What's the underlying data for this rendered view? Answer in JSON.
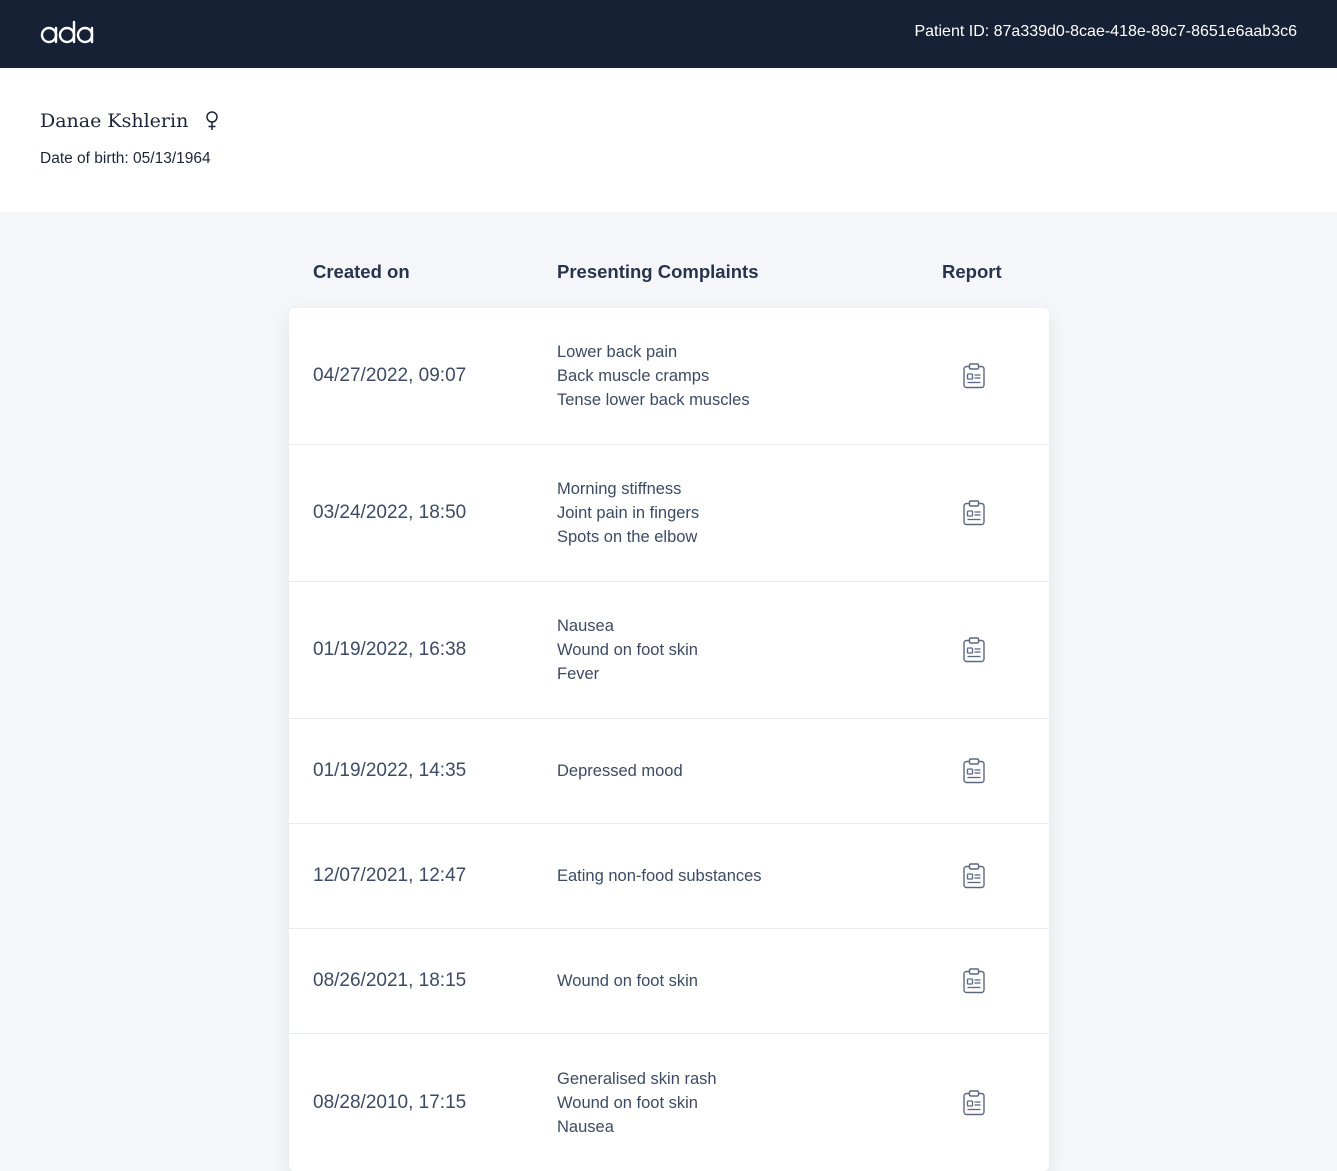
{
  "header": {
    "logo_text": "ada",
    "patient_id": "Patient ID: 87a339d0-8cae-418e-89c7-8651e6aab3c6"
  },
  "patient": {
    "name": "Danae Kshlerin",
    "gender_icon": "female-icon",
    "dob": "Date of birth: 05/13/1964"
  },
  "table": {
    "columns": {
      "created_on": "Created on",
      "complaints": "Presenting Complaints",
      "report": "Report"
    },
    "report_icon": "clipboard-report-icon",
    "rows": [
      {
        "date": "04/27/2022, 09:07",
        "complaints": [
          "Lower back pain",
          "Back muscle cramps",
          "Tense lower back muscles"
        ]
      },
      {
        "date": "03/24/2022, 18:50",
        "complaints": [
          "Morning stiffness",
          "Joint pain in fingers",
          "Spots on the elbow"
        ]
      },
      {
        "date": "01/19/2022, 16:38",
        "complaints": [
          "Nausea",
          "Wound on foot skin",
          "Fever"
        ]
      },
      {
        "date": "01/19/2022, 14:35",
        "complaints": [
          "Depressed mood"
        ]
      },
      {
        "date": "12/07/2021, 12:47",
        "complaints": [
          "Eating non-food substances"
        ]
      },
      {
        "date": "08/26/2021, 18:15",
        "complaints": [
          "Wound on foot skin"
        ]
      },
      {
        "date": "08/28/2010, 17:15",
        "complaints": [
          "Generalised skin rash",
          "Wound on foot skin",
          "Nausea"
        ]
      }
    ]
  },
  "colors": {
    "topbar_bg": "#162135",
    "page_bg": "#f4f6f9",
    "text_primary": "#1c2638",
    "text_secondary": "#3c4a63"
  }
}
